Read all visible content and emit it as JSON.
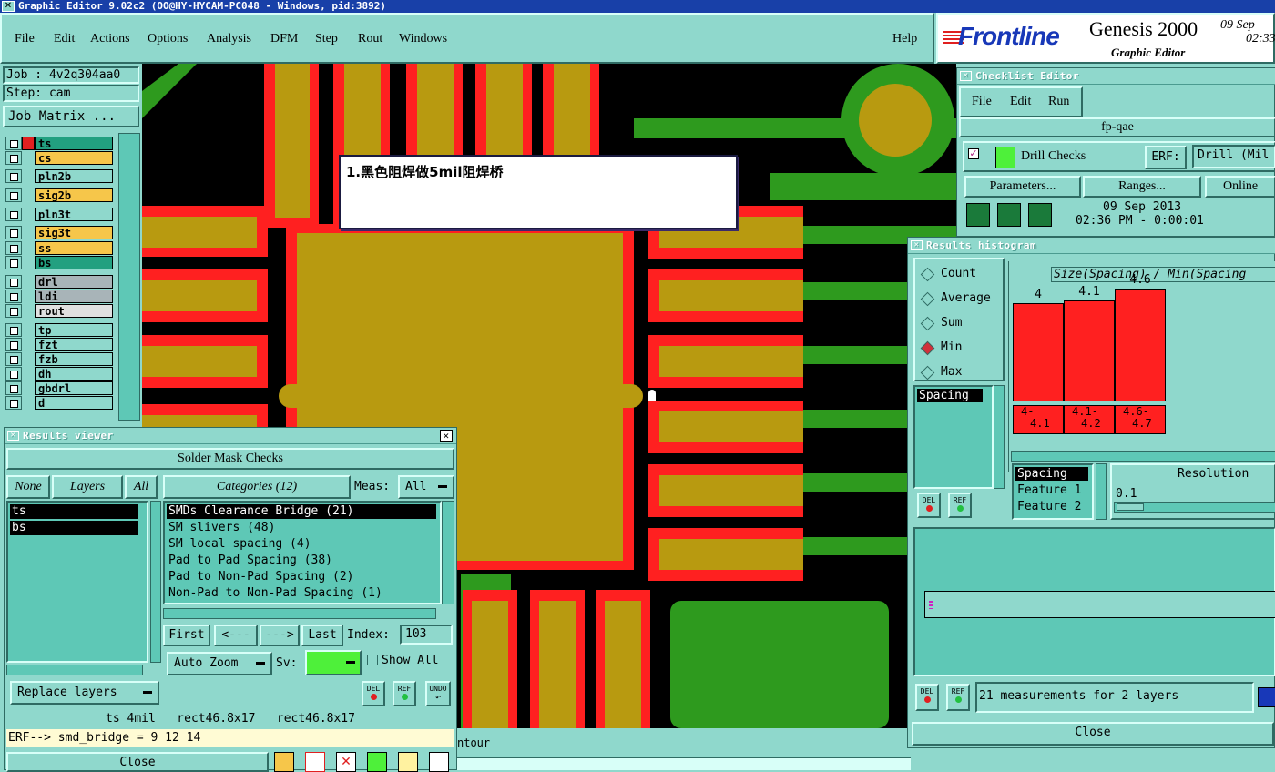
{
  "window": {
    "title": "Graphic Editor 9.02c2 (OO@HY-HYCAM-PC048 - Windows, pid:3892)"
  },
  "menu": {
    "items": [
      "File",
      "Edit",
      "Actions",
      "Options",
      "Analysis",
      "DFM",
      "Step",
      "Rout",
      "Windows"
    ],
    "help": "Help"
  },
  "brand": {
    "logo": "Frontline",
    "product": "Genesis 2000",
    "subtitle": "Graphic Editor",
    "date": "09 Sep",
    "time": "02:33"
  },
  "job": {
    "job_label": "Job : 4v2q304aa0",
    "step_label": "Step: cam",
    "matrix_button": "Job Matrix ..."
  },
  "layers": [
    {
      "name": "ts",
      "color": "#22a080",
      "group": 1
    },
    {
      "name": "cs",
      "color": "#f6c64a",
      "group": 1
    },
    {
      "name": "pln2b",
      "color": "#8fd8cc",
      "group": 2
    },
    {
      "name": "sig2b",
      "color": "#f6c64a",
      "group": 2
    },
    {
      "name": "pln3t",
      "color": "#8fd8cc",
      "group": 3
    },
    {
      "name": "sig3t",
      "color": "#f6c64a",
      "group": 3
    },
    {
      "name": "ss",
      "color": "#f6c64a",
      "group": 3
    },
    {
      "name": "bs",
      "color": "#22a080",
      "group": 3
    },
    {
      "name": "drl",
      "color": "#a8b4b8",
      "group": 4
    },
    {
      "name": "ldi",
      "color": "#a8b4b8",
      "group": 4
    },
    {
      "name": "rout",
      "color": "#e0e0e0",
      "group": 4
    },
    {
      "name": "tp",
      "color": "#8fd8cc",
      "group": 5
    },
    {
      "name": "fzt",
      "color": "#8fd8cc",
      "group": 5
    },
    {
      "name": "fzb",
      "color": "#8fd8cc",
      "group": 5
    },
    {
      "name": "dh",
      "color": "#8fd8cc",
      "group": 5
    },
    {
      "name": "gbdrl",
      "color": "#8fd8cc",
      "group": 5
    },
    {
      "name": "d",
      "color": "#8fd8cc",
      "group": 5
    }
  ],
  "annotation": {
    "note": "1.黑色阻焊做5mil阻焊桥"
  },
  "results_viewer": {
    "title": "Results viewer",
    "header": "Solder Mask Checks",
    "none_btn": "None",
    "layers_btn": "Layers",
    "all_btn": "All",
    "categories_btn": "Categories (12)",
    "meas_label": "Meas:",
    "meas_value": "All",
    "layer_list": [
      "ts",
      "bs"
    ],
    "categories": [
      "SMDs Clearance Bridge (21)",
      "SM slivers (48)",
      "SM local spacing (4)",
      "Pad to Pad Spacing (38)",
      "Pad to Non-Pad Spacing (2)",
      "Non-Pad to Non-Pad Spacing (1)"
    ],
    "nav": {
      "first": "First",
      "prev": "<---",
      "next": "--->",
      "last": "Last",
      "index_label": "Index:",
      "index_value": "103"
    },
    "auto_zoom": "Auto Zoom",
    "sv_label": "Sv:",
    "show_all": "Show All",
    "replace_layers": "Replace layers",
    "del": "DEL",
    "ref": "REF",
    "undo": "UNDO",
    "status": "ts 4mil   rect46.8x17   rect46.8x17",
    "erf": "ERF--> smd_bridge = 9 12 14",
    "close": "Close"
  },
  "checklist": {
    "title": "Checklist Editor",
    "menu": [
      "File",
      "Edit",
      "Run"
    ],
    "name": "fp-qae",
    "check_name": "Drill Checks",
    "erf_label": "ERF:",
    "erf_value": "Drill (Mil",
    "parameters": "Parameters...",
    "ranges": "Ranges...",
    "online": "Online",
    "date": "09 Sep 2013",
    "time": "02:36 PM - 0:00:01"
  },
  "histogram": {
    "title": "Results histogram",
    "modes": [
      "Count",
      "Average",
      "Sum",
      "Min",
      "Max"
    ],
    "selected_mode": "Min",
    "chart_title": "Size(Spacing) / Min(Spacing",
    "list_top": "Spacing",
    "list_bottom": [
      "Spacing",
      "Feature 1",
      "Feature 2"
    ],
    "resolution_label": "Resolution",
    "resolution_value": "0.1",
    "summary": "21 measurements for 2 layers",
    "del": "DEL",
    "ref": "REF",
    "close": "Close",
    "chart_data": {
      "type": "bar",
      "categories": [
        "4-4.1",
        "4.1-4.2",
        "4.6-4.7"
      ],
      "category_lines": [
        [
          "4-",
          "4.1"
        ],
        [
          "4.1-",
          "4.2"
        ],
        [
          "4.6-",
          "4.7"
        ]
      ],
      "values": [
        4,
        4.1,
        4.6
      ],
      "value_labels": [
        "4",
        "4.1",
        "4.6"
      ],
      "bar_color": "#ff2020"
    }
  },
  "footer": {
    "contour": "ntour"
  }
}
